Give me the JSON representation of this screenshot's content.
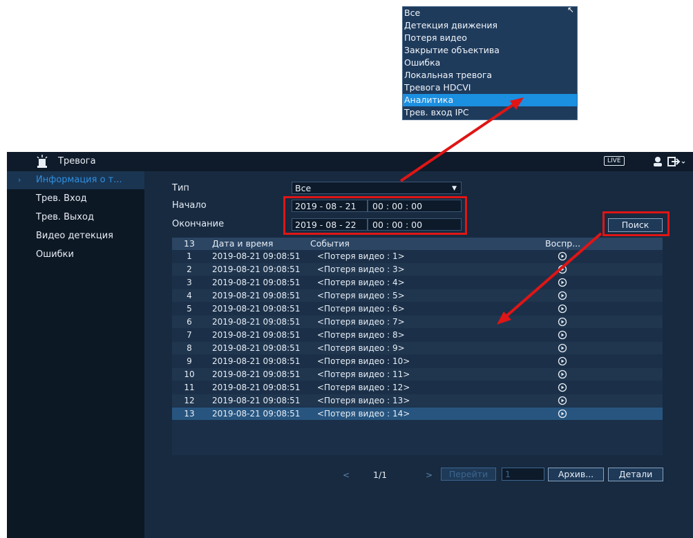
{
  "dropdown": {
    "options": [
      "Все",
      "Детекция движения",
      "Потеря видео",
      "Закрытие объектива",
      "Ошибка",
      "Локальная тревога",
      "Тревога HDCVI",
      "Аналитика",
      "Трев. вход IPC"
    ],
    "selected_index": 7
  },
  "header": {
    "title": "Тревога",
    "live_badge": "LIVE"
  },
  "sidebar": {
    "items": [
      {
        "label": "Информация о т...",
        "active": true
      },
      {
        "label": "Трев. Вход",
        "active": false
      },
      {
        "label": "Трев. Выход",
        "active": false
      },
      {
        "label": "Видео детекция",
        "active": false
      },
      {
        "label": "Ошибки",
        "active": false
      }
    ]
  },
  "form": {
    "type_label": "Тип",
    "type_value": "Все",
    "start_label": "Начало",
    "start_date": "2019 - 08 - 21",
    "start_time": "00 : 00 : 00",
    "end_label": "Окончание",
    "end_date": "2019 - 08 - 22",
    "end_time": "00 : 00 : 00",
    "search_button": "Поиск"
  },
  "table": {
    "count": "13",
    "col_date": "Дата и время",
    "col_events": "События",
    "col_play": "Воспр...",
    "rows": [
      {
        "num": "1",
        "date": "2019-08-21 09:08:51",
        "event": "<Потеря видео : 1>"
      },
      {
        "num": "2",
        "date": "2019-08-21 09:08:51",
        "event": "<Потеря видео : 3>"
      },
      {
        "num": "3",
        "date": "2019-08-21 09:08:51",
        "event": "<Потеря видео : 4>"
      },
      {
        "num": "4",
        "date": "2019-08-21 09:08:51",
        "event": "<Потеря видео : 5>"
      },
      {
        "num": "5",
        "date": "2019-08-21 09:08:51",
        "event": "<Потеря видео : 6>"
      },
      {
        "num": "6",
        "date": "2019-08-21 09:08:51",
        "event": "<Потеря видео : 7>"
      },
      {
        "num": "7",
        "date": "2019-08-21 09:08:51",
        "event": "<Потеря видео : 8>"
      },
      {
        "num": "8",
        "date": "2019-08-21 09:08:51",
        "event": "<Потеря видео : 9>"
      },
      {
        "num": "9",
        "date": "2019-08-21 09:08:51",
        "event": "<Потеря видео : 10>"
      },
      {
        "num": "10",
        "date": "2019-08-21 09:08:51",
        "event": "<Потеря видео : 11>"
      },
      {
        "num": "11",
        "date": "2019-08-21 09:08:51",
        "event": "<Потеря видео : 12>"
      },
      {
        "num": "12",
        "date": "2019-08-21 09:08:51",
        "event": "<Потеря видео : 13>"
      },
      {
        "num": "13",
        "date": "2019-08-21 09:08:51",
        "event": "<Потеря видео : 14>"
      }
    ],
    "selected_row": 12
  },
  "pagination": {
    "prev": "<",
    "page": "1/1",
    "next": ">",
    "goto_button": "Перейти",
    "goto_value": "1",
    "archive_button": "Архив...",
    "details_button": "Детали"
  },
  "colors": {
    "annotation": "#e01515",
    "accent": "#1b8fe0"
  }
}
